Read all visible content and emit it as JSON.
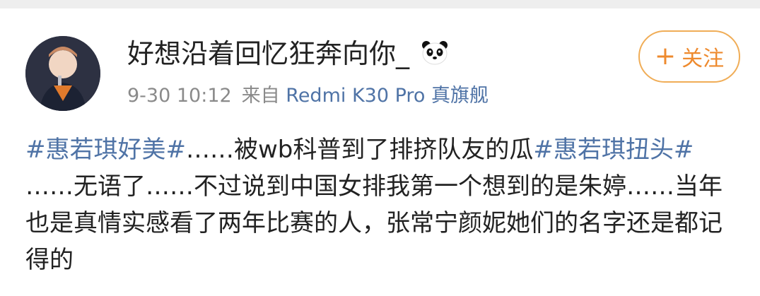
{
  "post": {
    "username": "好想沿着回忆狂奔向你_",
    "username_badge_icon": "panda-emoji",
    "time": "9-30 10:12",
    "source_prefix": "来自",
    "source_device": "Redmi K30 Pro 真旗舰",
    "follow_label": "关注",
    "follow_plus": "+",
    "content": {
      "tag1": "#惠若琪好美#",
      "text1": "……被wb科普到了排挤队友的瓜",
      "tag2": "#惠若琪扭头#",
      "text2": " ……无语了……不过说到中国女排我第一个想到的是朱婷……当年也是真情实感看了两年比赛的人，张常宁颜妮她们的名字还是都记得的"
    }
  },
  "colors": {
    "link": "#4f73a6",
    "follow_accent": "#ee8a2e",
    "meta": "#8a8a8a"
  }
}
